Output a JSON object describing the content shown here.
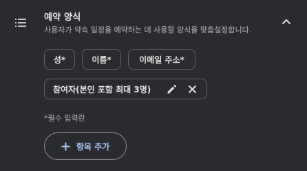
{
  "section": {
    "title": "예약 양식",
    "subtitle": "사용자가 약속 일정을 예약하는 데 사용할 양식을 맞춤설정합니다.",
    "list_icon": "list-icon",
    "collapse_icon": "chevron-up-icon"
  },
  "fields": {
    "items": [
      {
        "label": "성*"
      },
      {
        "label": "이름*"
      },
      {
        "label": "이메일 주소*"
      }
    ],
    "custom": {
      "label": "참여자(본인 포함 최대 3명)",
      "edit_icon": "pencil-icon",
      "remove_icon": "close-icon"
    }
  },
  "required_note": "*필수 입력란",
  "add_button": {
    "label": "항목 추가",
    "icon": "plus-icon"
  },
  "colors": {
    "background": "#2a2b2e",
    "text": "#e3e3e3",
    "muted": "#b4b6ba",
    "accent": "#a8c7fa",
    "chip_border": "#5f6267"
  }
}
